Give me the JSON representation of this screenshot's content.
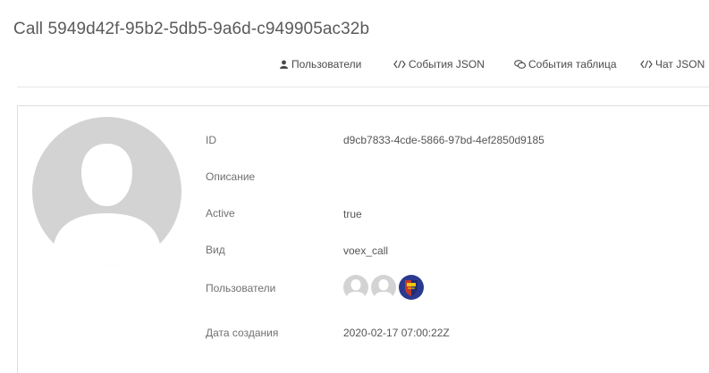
{
  "page": {
    "title": "Call 5949d42f-95b2-5db5-9a6d-c949905ac32b"
  },
  "nav": {
    "items": [
      {
        "label": "Пользователи",
        "icon": "users-icon"
      },
      {
        "label": "События JSON",
        "icon": "code-icon"
      },
      {
        "label": "События таблица",
        "icon": "chat-bubbles-icon"
      },
      {
        "label": "Чат JSON",
        "icon": "code-icon"
      }
    ]
  },
  "details": {
    "id_label": "ID",
    "id_value": "d9cb7833-4cde-5866-97bd-4ef2850d9185",
    "description_label": "Описание",
    "description_value": "",
    "active_label": "Active",
    "active_value": "true",
    "kind_label": "Вид",
    "kind_value": "voex_call",
    "users_label": "Пользователи",
    "users": [
      {
        "icon": "user-placeholder-icon"
      },
      {
        "icon": "user-placeholder-icon"
      },
      {
        "icon": "user-avatar-icon"
      }
    ],
    "created_label": "Дата создания",
    "created_value": "2020-02-17 07:00:22Z"
  },
  "colors": {
    "text": "#555555",
    "avatar_bg": "#d3d3d3",
    "avatar_fg": "#ffffff",
    "rule": "#e6e6e6",
    "user_avatar_blue": "#2b3a8f",
    "user_avatar_red": "#c0392b"
  }
}
